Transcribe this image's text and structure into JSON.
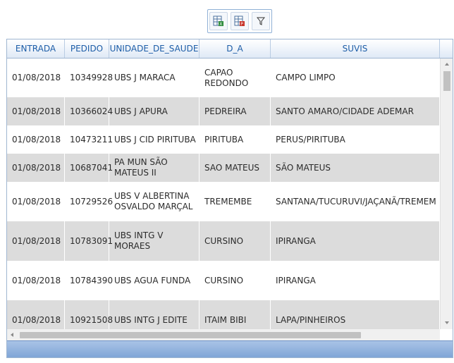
{
  "toolbar": {
    "buttons": [
      {
        "name": "export-excel",
        "icon": "excel-export-icon"
      },
      {
        "name": "export-pdf",
        "icon": "pdf-export-icon"
      },
      {
        "name": "filter",
        "icon": "filter-icon"
      }
    ]
  },
  "table": {
    "columns": [
      "ENTRADA",
      "PEDIDO",
      "UNIDADE_DE_SAUDE",
      "D_A",
      "SUVIS"
    ],
    "rows": [
      [
        "01/08/2018",
        "10349928",
        "UBS J MARACA",
        "CAPAO REDONDO",
        "CAMPO LIMPO"
      ],
      [
        "01/08/2018",
        "10366024",
        "UBS J APURA",
        "PEDREIRA",
        "SANTO AMARO/CIDADE ADEMAR"
      ],
      [
        "01/08/2018",
        "10473211",
        "UBS J CID PIRITUBA",
        "PIRITUBA",
        "PERUS/PIRITUBA"
      ],
      [
        "01/08/2018",
        "10687041",
        "PA MUN SÃO MATEUS II",
        "SAO MATEUS",
        "SÃO MATEUS"
      ],
      [
        "01/08/2018",
        "10729526",
        "UBS V ALBERTINA OSVALDO MARÇAL",
        "TREMEMBE",
        "SANTANA/TUCURUVI/JAÇANÃ/TREMEM"
      ],
      [
        "01/08/2018",
        "10783091",
        "UBS INTG V MORAES",
        "CURSINO",
        "IPIRANGA"
      ],
      [
        "01/08/2018",
        "10784390",
        "UBS AGUA FUNDA",
        "CURSINO",
        "IPIRANGA"
      ],
      [
        "01/08/2018",
        "10921508",
        "UBS INTG J EDITE",
        "ITAIM BIBI",
        "LAPA/PINHEIROS"
      ]
    ]
  },
  "colors": {
    "header_text": "#1e5ea8",
    "row_alt": "#dcdcdc",
    "pager": "#7ea4d6"
  }
}
